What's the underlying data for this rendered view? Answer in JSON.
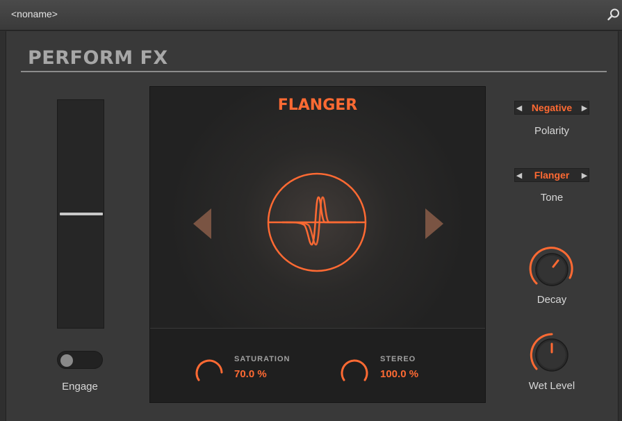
{
  "window": {
    "title": "<noname>"
  },
  "panel": {
    "title": "PERFORM FX"
  },
  "engage": {
    "label": "Engage",
    "on": false,
    "fader_level": 0.5
  },
  "effect": {
    "name": "FLANGER",
    "params": [
      {
        "name": "SATURATION",
        "value": "70.0 %"
      },
      {
        "name": "STEREO",
        "value": "100.0 %"
      }
    ]
  },
  "controls": {
    "polarity": {
      "value": "Negative",
      "label": "Polarity"
    },
    "tone": {
      "value": "Flanger",
      "label": "Tone"
    },
    "decay": {
      "label": "Decay"
    },
    "wet_level": {
      "label": "Wet Level"
    }
  },
  "colors": {
    "accent": "#ff6a33",
    "background": "#393939",
    "display": "#1f1f1f"
  }
}
